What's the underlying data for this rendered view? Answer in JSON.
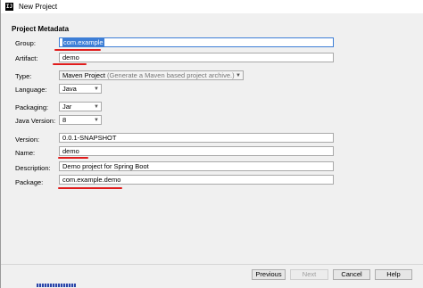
{
  "window": {
    "title": "New Project",
    "app_icon_glyph": "IJ"
  },
  "section": {
    "title": "Project Metadata"
  },
  "fields": {
    "group": {
      "label": "Group:",
      "value": "com.example"
    },
    "artifact": {
      "label": "Artifact:",
      "value": "demo"
    },
    "type": {
      "label": "Type:",
      "value": "Maven Project",
      "hint": "(Generate a Maven based project archive.)"
    },
    "language": {
      "label": "Language:",
      "value": "Java"
    },
    "packaging": {
      "label": "Packaging:",
      "value": "Jar"
    },
    "java_version": {
      "label": "Java Version:",
      "value": "8"
    },
    "version": {
      "label": "Version:",
      "value": "0.0.1-SNAPSHOT"
    },
    "name": {
      "label": "Name:",
      "value": "demo"
    },
    "description": {
      "label": "Description:",
      "value": "Demo project for Spring Boot"
    },
    "package": {
      "label": "Package:",
      "value": "com.example.demo"
    }
  },
  "buttons": {
    "previous": "Previous",
    "next": "Next",
    "cancel": "Cancel",
    "help": "Help"
  },
  "icons": {
    "dropdown": "chevron-down-icon"
  },
  "colors": {
    "focus": "#3d7ed6",
    "annotation": "#e01c1c"
  }
}
